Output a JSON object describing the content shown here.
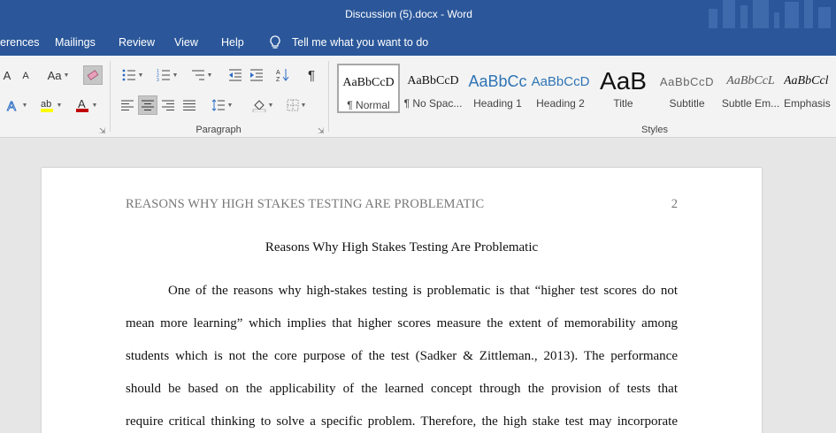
{
  "window": {
    "title": "Discussion (5).docx  -  Word"
  },
  "tabs": [
    "erences",
    "Mailings",
    "Review",
    "View",
    "Help"
  ],
  "tell_me": "Tell me what you want to do",
  "ribbon": {
    "paragraph_label": "Paragraph",
    "styles_label": "Styles",
    "styles": [
      {
        "sample": "AaBbCcD",
        "name": "¶ Normal"
      },
      {
        "sample": "AaBbCcD",
        "name": "¶ No Spac..."
      },
      {
        "sample": "AaBbCc",
        "name": "Heading 1"
      },
      {
        "sample": "AaBbCcD",
        "name": "Heading 2"
      },
      {
        "sample": "AaB",
        "name": "Title"
      },
      {
        "sample": "AaBbCcD",
        "name": "Subtitle"
      },
      {
        "sample": "AaBbCcL",
        "name": "Subtle Em..."
      },
      {
        "sample": "AaBbCcl",
        "name": "Emphasis"
      }
    ],
    "font_size_grow": "A",
    "font_size_shrink": "A",
    "change_case": "Aa",
    "pilcrow": "¶"
  },
  "colors": {
    "accent": "#2b579a",
    "font_color": "#c00000",
    "highlight": "#ffff00"
  },
  "document": {
    "header": "REASONS WHY HIGH STAKES TESTING ARE PROBLEMATIC",
    "page_number": "2",
    "title": "Reasons Why High Stakes Testing Are Problematic",
    "lines": [
      "One of the reasons why high-stakes testing is problematic is that “higher test scores do not",
      "mean more learning” which implies that higher scores measure the extent of memorability among",
      "students which is not the core purpose of the test (Sadker & Zittleman., 2013). The performance",
      "should be based on the applicability of the learned concept through the provision of tests that",
      "require critical thinking to solve a specific problem. Therefore, the high stake test may incorporate"
    ]
  }
}
